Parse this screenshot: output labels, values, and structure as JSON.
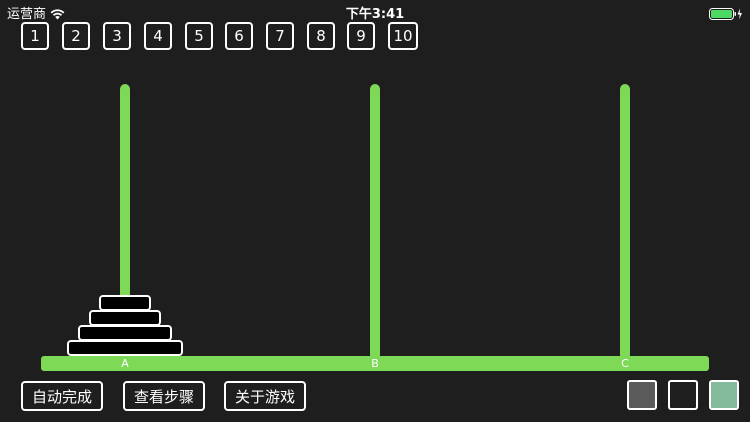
{
  "status_bar": {
    "carrier": "运营商",
    "time": "下午3:41",
    "wifi_icon": "wifi-icon",
    "battery_icon": "battery-charging-icon",
    "battery_level": 1.0
  },
  "disk_count_options": [
    "1",
    "2",
    "3",
    "4",
    "5",
    "6",
    "7",
    "8",
    "9",
    "10"
  ],
  "board": {
    "pegs": [
      {
        "label": "A",
        "disk_count": 4
      },
      {
        "label": "B",
        "disk_count": 0
      },
      {
        "label": "C",
        "disk_count": 0
      }
    ],
    "peg_color": "#7ed957",
    "disk_fill": "#000000",
    "disk_border": "#ffffff"
  },
  "actions": {
    "auto_complete": "自动完成",
    "view_steps": "查看步骤",
    "about_game": "关于游戏"
  },
  "theme_swatches": [
    {
      "name": "gray",
      "color": "#5a5a5a"
    },
    {
      "name": "black",
      "color": "#1e1e1e"
    },
    {
      "name": "green",
      "color": "#85bb9d"
    }
  ],
  "colors": {
    "background": "#1e1e1e",
    "accent": "#7ed957"
  }
}
